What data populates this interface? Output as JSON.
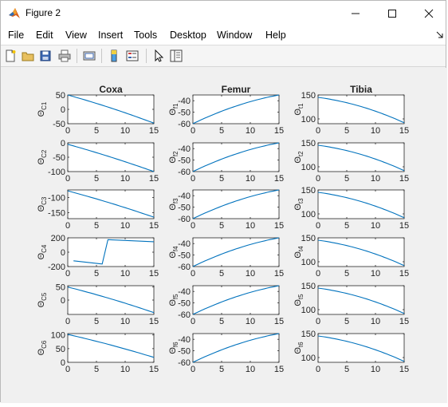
{
  "window": {
    "title": "Figure 2"
  },
  "menu": [
    "File",
    "Edit",
    "View",
    "Insert",
    "Tools",
    "Desktop",
    "Window",
    "Help"
  ],
  "toolbar": [
    "new-figure",
    "open-file",
    "save",
    "print",
    "print-preview",
    "insert-colorbar",
    "insert-legend",
    "edit-plot",
    "property-editor"
  ],
  "colors": {
    "line": "#0072BD",
    "axes_bg": "#ffffff",
    "figure_bg": "#f0f0f0"
  },
  "chart_data": [
    {
      "type": "line",
      "title": "Coxa",
      "ylabel": "ΘC1",
      "x": [
        0,
        15
      ],
      "xlim": [
        0,
        15
      ],
      "xticks": [
        0,
        5,
        10,
        15
      ],
      "ylim": [
        -50,
        50
      ],
      "yticks": [
        -50,
        0,
        50
      ],
      "series": [
        {
          "values": [
            50,
            -48
          ],
          "curve": 0.15
        }
      ]
    },
    {
      "type": "line",
      "title": "Femur",
      "ylabel": "Θf1",
      "x": [
        0,
        15
      ],
      "xlim": [
        0,
        15
      ],
      "xticks": [
        0,
        5,
        10,
        15
      ],
      "ylim": [
        -60,
        -35
      ],
      "yticks": [
        -60,
        -50,
        -40
      ],
      "series": [
        {
          "values": [
            -60,
            -35
          ],
          "curve": -0.45
        }
      ]
    },
    {
      "type": "line",
      "title": "Tibia",
      "ylabel": "Θt1",
      "x": [
        0,
        15
      ],
      "xlim": [
        0,
        15
      ],
      "xticks": [
        0,
        5,
        10,
        15
      ],
      "ylim": [
        90,
        150
      ],
      "yticks": [
        100,
        150
      ],
      "series": [
        {
          "values": [
            145,
            92
          ],
          "curve": 0.55
        }
      ]
    },
    {
      "type": "line",
      "title": "",
      "ylabel": "ΘC2",
      "x": [
        0,
        15
      ],
      "xlim": [
        0,
        15
      ],
      "xticks": [
        0,
        5,
        10,
        15
      ],
      "ylim": [
        -100,
        0
      ],
      "yticks": [
        -100,
        -50,
        0
      ],
      "series": [
        {
          "values": [
            -5,
            -100
          ],
          "curve": 0.12
        }
      ]
    },
    {
      "type": "line",
      "title": "",
      "ylabel": "Θf2",
      "x": [
        0,
        15
      ],
      "xlim": [
        0,
        15
      ],
      "xticks": [
        0,
        5,
        10,
        15
      ],
      "ylim": [
        -60,
        -35
      ],
      "yticks": [
        -60,
        -50,
        -40
      ],
      "series": [
        {
          "values": [
            -60,
            -35
          ],
          "curve": -0.45
        }
      ]
    },
    {
      "type": "line",
      "title": "",
      "ylabel": "Θt2",
      "x": [
        0,
        15
      ],
      "xlim": [
        0,
        15
      ],
      "xticks": [
        0,
        5,
        10,
        15
      ],
      "ylim": [
        90,
        150
      ],
      "yticks": [
        100,
        150
      ],
      "series": [
        {
          "values": [
            145,
            92
          ],
          "curve": 0.55
        }
      ]
    },
    {
      "type": "line",
      "title": "",
      "ylabel": "ΘC3",
      "x": [
        0,
        15
      ],
      "xlim": [
        0,
        15
      ],
      "xticks": [
        0,
        5,
        10,
        15
      ],
      "ylim": [
        -170,
        -75
      ],
      "yticks": [
        -150,
        -100
      ],
      "series": [
        {
          "values": [
            -78,
            -165
          ],
          "curve": 0.12
        }
      ]
    },
    {
      "type": "line",
      "title": "",
      "ylabel": "Θf3",
      "x": [
        0,
        15
      ],
      "xlim": [
        0,
        15
      ],
      "xticks": [
        0,
        5,
        10,
        15
      ],
      "ylim": [
        -60,
        -35
      ],
      "yticks": [
        -60,
        -50,
        -40
      ],
      "series": [
        {
          "values": [
            -60,
            -35
          ],
          "curve": -0.45
        }
      ]
    },
    {
      "type": "line",
      "title": "",
      "ylabel": "Θt3",
      "x": [
        0,
        15
      ],
      "xlim": [
        0,
        15
      ],
      "xticks": [
        0,
        5,
        10,
        15
      ],
      "ylim": [
        90,
        150
      ],
      "yticks": [
        100,
        150
      ],
      "series": [
        {
          "values": [
            145,
            92
          ],
          "curve": 0.55
        }
      ]
    },
    {
      "type": "line",
      "title": "",
      "ylabel": "ΘC4",
      "x": [
        0,
        15
      ],
      "xlim": [
        0,
        15
      ],
      "xticks": [
        0,
        5,
        10,
        15
      ],
      "ylim": [
        -200,
        200
      ],
      "yticks": [
        -200,
        0,
        200
      ],
      "series": [
        {
          "points": [
            [
              1,
              -120
            ],
            [
              6,
              -165
            ],
            [
              7,
              175
            ],
            [
              15,
              145
            ]
          ]
        }
      ]
    },
    {
      "type": "line",
      "title": "",
      "ylabel": "Θf4",
      "x": [
        0,
        15
      ],
      "xlim": [
        0,
        15
      ],
      "xticks": [
        0,
        5,
        10,
        15
      ],
      "ylim": [
        -60,
        -35
      ],
      "yticks": [
        -60,
        -50,
        -40
      ],
      "series": [
        {
          "values": [
            -60,
            -35
          ],
          "curve": -0.45
        }
      ]
    },
    {
      "type": "line",
      "title": "",
      "ylabel": "Θt4",
      "x": [
        0,
        15
      ],
      "xlim": [
        0,
        15
      ],
      "xticks": [
        0,
        5,
        10,
        15
      ],
      "ylim": [
        90,
        150
      ],
      "yticks": [
        100,
        150
      ],
      "series": [
        {
          "values": [
            145,
            92
          ],
          "curve": 0.55
        }
      ]
    },
    {
      "type": "line",
      "title": "",
      "ylabel": "ΘC5",
      "x": [
        0,
        15
      ],
      "xlim": [
        0,
        15
      ],
      "xticks": [
        0,
        5,
        10,
        15
      ],
      "ylim": [
        -55,
        55
      ],
      "yticks": [
        0,
        50
      ],
      "series": [
        {
          "values": [
            50,
            -48
          ],
          "curve": 0.15
        }
      ]
    },
    {
      "type": "line",
      "title": "",
      "ylabel": "Θf5",
      "x": [
        0,
        15
      ],
      "xlim": [
        0,
        15
      ],
      "xticks": [
        0,
        5,
        10,
        15
      ],
      "ylim": [
        -60,
        -35
      ],
      "yticks": [
        -60,
        -50,
        -40
      ],
      "series": [
        {
          "values": [
            -60,
            -35
          ],
          "curve": -0.45
        }
      ]
    },
    {
      "type": "line",
      "title": "",
      "ylabel": "Θt5",
      "x": [
        0,
        15
      ],
      "xlim": [
        0,
        15
      ],
      "xticks": [
        0,
        5,
        10,
        15
      ],
      "ylim": [
        90,
        150
      ],
      "yticks": [
        100,
        150
      ],
      "series": [
        {
          "values": [
            145,
            92
          ],
          "curve": 0.55
        }
      ]
    },
    {
      "type": "line",
      "title": "",
      "ylabel": "ΘC6",
      "x": [
        0,
        15
      ],
      "xlim": [
        0,
        15
      ],
      "xticks": [
        0,
        5,
        10,
        15
      ],
      "ylim": [
        0,
        105
      ],
      "yticks": [
        0,
        50,
        100
      ],
      "series": [
        {
          "values": [
            102,
            18
          ],
          "curve": 0.15
        }
      ]
    },
    {
      "type": "line",
      "title": "",
      "ylabel": "Θf6",
      "x": [
        0,
        15
      ],
      "xlim": [
        0,
        15
      ],
      "xticks": [
        0,
        5,
        10,
        15
      ],
      "ylim": [
        -60,
        -35
      ],
      "yticks": [
        -60,
        -50,
        -40
      ],
      "series": [
        {
          "values": [
            -60,
            -35
          ],
          "curve": -0.45
        }
      ]
    },
    {
      "type": "line",
      "title": "",
      "ylabel": "Θt6",
      "x": [
        0,
        15
      ],
      "xlim": [
        0,
        15
      ],
      "xticks": [
        0,
        5,
        10,
        15
      ],
      "ylim": [
        90,
        150
      ],
      "yticks": [
        100,
        150
      ],
      "series": [
        {
          "values": [
            145,
            92
          ],
          "curve": 0.55
        }
      ]
    }
  ]
}
